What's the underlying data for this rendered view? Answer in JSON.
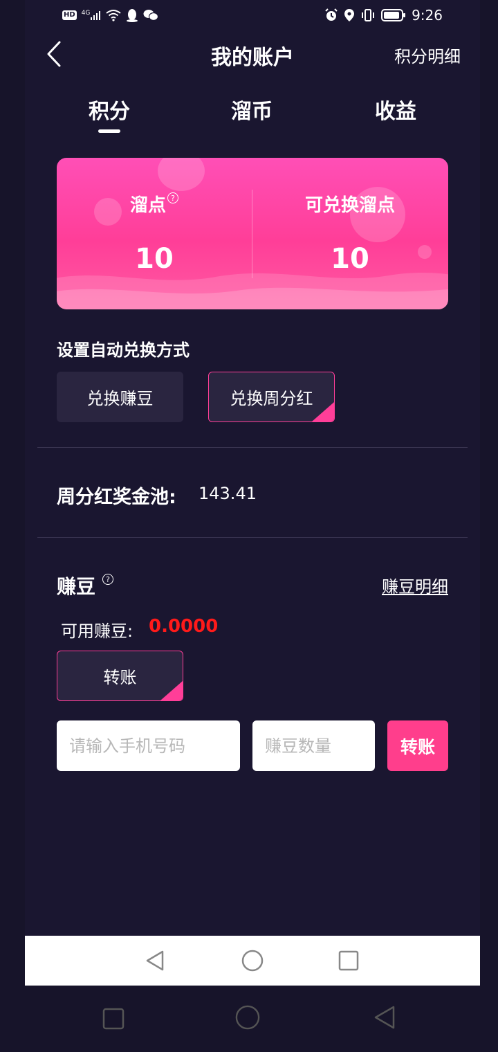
{
  "status_bar": {
    "left_icons": [
      "hd-icon",
      "signal-4g-icon",
      "wifi-icon",
      "qq-icon",
      "wechat-icon"
    ],
    "hd_label": "HD",
    "network_label": "4G",
    "right_icons": [
      "alarm-icon",
      "location-icon",
      "vibrate-icon",
      "battery-icon"
    ],
    "time": "9:26"
  },
  "header": {
    "title": "我的账户",
    "right_link": "积分明细"
  },
  "tabs": [
    {
      "label": "积分",
      "active": true
    },
    {
      "label": "溜币",
      "active": false
    },
    {
      "label": "收益",
      "active": false
    }
  ],
  "points_card": {
    "left_label": "溜点",
    "left_value": "10",
    "right_label": "可兑换溜点",
    "right_value": "10"
  },
  "auto_exchange": {
    "label": "设置自动兑换方式",
    "options": [
      {
        "label": "兑换赚豆",
        "selected": false
      },
      {
        "label": "兑换周分红",
        "selected": true
      }
    ]
  },
  "bonus_pool": {
    "label": "周分红奖金池:",
    "value": "143.41"
  },
  "beans": {
    "title": "赚豆",
    "detail_link": "赚豆明细",
    "available_label": "可用赚豆:",
    "available_value": "0.0000",
    "transfer_toggle": "转账",
    "phone_placeholder": "请输入手机号码",
    "amount_placeholder": "赚豆数量",
    "submit_label": "转账"
  },
  "colors": {
    "accent": "#ff3e98",
    "background": "#1a1630",
    "value_red": "#ff1a1a"
  }
}
